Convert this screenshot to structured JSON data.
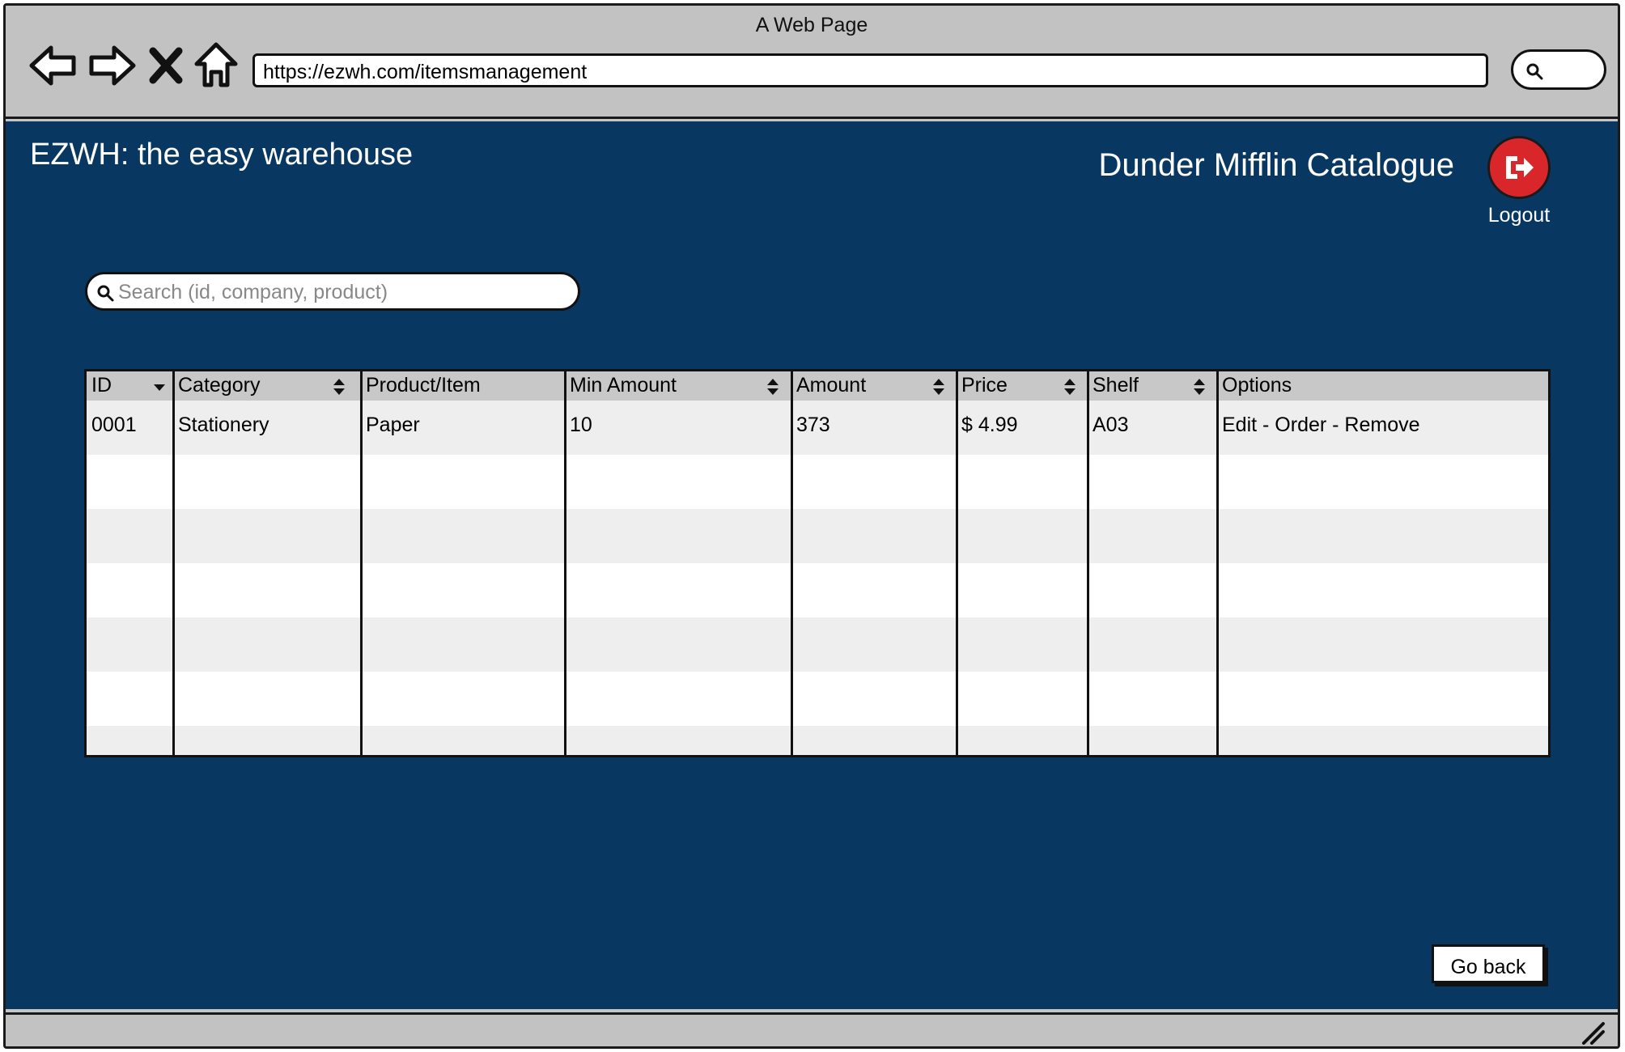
{
  "browser": {
    "window_title": "A Web Page",
    "url": "https://ezwh.com/itemsmanagement",
    "icons": [
      "back-arrow-icon",
      "forward-arrow-icon",
      "close-x-icon",
      "home-icon",
      "search-icon"
    ]
  },
  "header": {
    "brand": "EZWH: the easy warehouse",
    "catalogue_title": "Dunder Mifflin Catalogue",
    "logout_label": "Logout",
    "logout_icon": "logout-icon",
    "logout_color": "#d8262a"
  },
  "search": {
    "placeholder": "Search (id, company, product)",
    "value": ""
  },
  "table": {
    "columns": [
      {
        "label": "ID",
        "sort": "descending"
      },
      {
        "label": "Category",
        "sort": "sortable"
      },
      {
        "label": "Product/Item",
        "sort": "none"
      },
      {
        "label": "Min Amount",
        "sort": "sortable"
      },
      {
        "label": "Amount",
        "sort": "sortable"
      },
      {
        "label": "Price",
        "sort": "sortable"
      },
      {
        "label": "Shelf",
        "sort": "sortable"
      },
      {
        "label": "Options",
        "sort": "none"
      }
    ],
    "rows": [
      [
        "0001",
        "Stationery",
        "Paper",
        "10",
        "373",
        "$ 4.99",
        "A03",
        "Edit - Order - Remove"
      ]
    ],
    "empty_rows": 7
  },
  "footer": {
    "go_back_label": "Go back"
  },
  "colors": {
    "page_background": "#083862",
    "header_row": "#c8c8c8",
    "row_alt": "#eeeeee",
    "chrome": "#c2c2c2"
  }
}
